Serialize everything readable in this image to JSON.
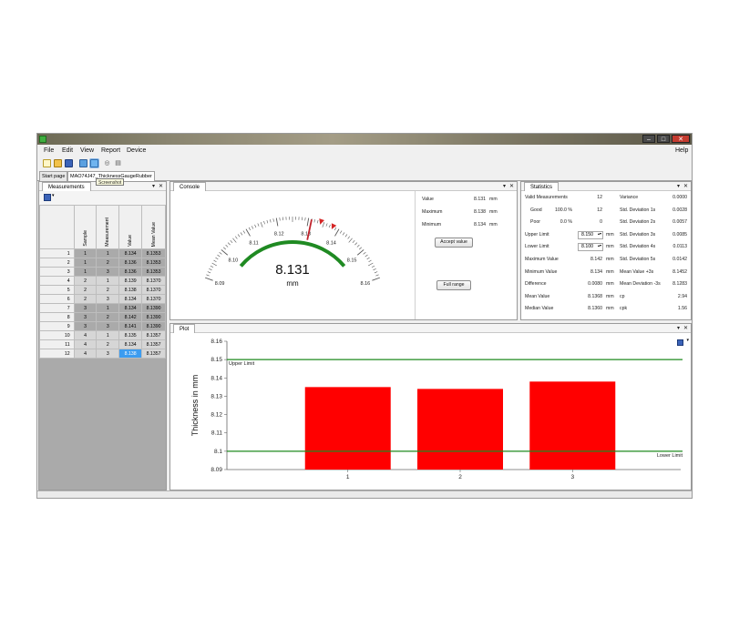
{
  "window": {
    "minimize": "–",
    "maximize": "□",
    "close": "✕"
  },
  "menu": {
    "items": [
      "File",
      "Edit",
      "View",
      "Report",
      "Device"
    ],
    "help": "Help"
  },
  "toolbar": {
    "icons": [
      "new-file-icon",
      "open-folder-icon",
      "save-icon",
      "chart-icon",
      "screenshot-icon",
      "binoculars-icon",
      "print-icon"
    ]
  },
  "doc_tabs": [
    "Start page",
    "MAO74J47_ThicknessGaugeRubber"
  ],
  "tooltip": "Screenshot",
  "measurements": {
    "title": "Measurements",
    "columns": [
      "Sample",
      "Measurement",
      "Value",
      "Mean Value"
    ],
    "rows": [
      {
        "row": "1",
        "sample": "1",
        "measurement": "1",
        "value": "8.134",
        "mean": "8.1353"
      },
      {
        "row": "2",
        "sample": "1",
        "measurement": "2",
        "value": "8.136",
        "mean": "8.1353"
      },
      {
        "row": "3",
        "sample": "1",
        "measurement": "3",
        "value": "8.136",
        "mean": "8.1353"
      },
      {
        "row": "4",
        "sample": "2",
        "measurement": "1",
        "value": "8.139",
        "mean": "8.1370"
      },
      {
        "row": "5",
        "sample": "2",
        "measurement": "2",
        "value": "8.138",
        "mean": "8.1370"
      },
      {
        "row": "6",
        "sample": "2",
        "measurement": "3",
        "value": "8.134",
        "mean": "8.1370"
      },
      {
        "row": "7",
        "sample": "3",
        "measurement": "1",
        "value": "8.134",
        "mean": "8.1390"
      },
      {
        "row": "8",
        "sample": "3",
        "measurement": "2",
        "value": "8.142",
        "mean": "8.1390"
      },
      {
        "row": "9",
        "sample": "3",
        "measurement": "3",
        "value": "8.141",
        "mean": "8.1390"
      },
      {
        "row": "10",
        "sample": "4",
        "measurement": "1",
        "value": "8.135",
        "mean": "8.1357"
      },
      {
        "row": "11",
        "sample": "4",
        "measurement": "2",
        "value": "8.134",
        "mean": "8.1357"
      },
      {
        "row": "12",
        "sample": "4",
        "measurement": "3",
        "value": "8.138",
        "mean": "8.1357"
      }
    ]
  },
  "console": {
    "title": "Console",
    "gauge": {
      "min": 8.09,
      "max": 8.16,
      "value": 8.131,
      "tick_labels": [
        "8.09",
        "8.10",
        "8.11",
        "8.12",
        "8.13",
        "8.14",
        "8.15",
        "8.16"
      ],
      "display": "8.131",
      "unit": "mm",
      "green_range": [
        8.1,
        8.15
      ],
      "last_value_marker": 8.138,
      "max_marker": 8.138,
      "min_marker": 8.134,
      "colors": {
        "needle": "#c0222b",
        "band": "#1f8a22",
        "marker": "#d42525"
      }
    },
    "readouts": [
      {
        "label": "Value",
        "value": "8.131",
        "unit": "mm"
      },
      {
        "label": "Maximum",
        "value": "8.138",
        "unit": "mm"
      },
      {
        "label": "Minimum",
        "value": "8.134",
        "unit": "mm"
      }
    ],
    "accept_button": "Accept value",
    "full_range_button": "Full range"
  },
  "statistics": {
    "title": "Statistics",
    "left": [
      {
        "label": "Valid Measurements",
        "value": "12"
      },
      {
        "label": "Good",
        "pct": "100.0 %",
        "value": "12"
      },
      {
        "label": "Poor",
        "pct": "0.0 %",
        "value": "0"
      },
      {
        "label": "Upper Limit",
        "value": "8.150",
        "unit": "mm"
      },
      {
        "label": "Lower Limit",
        "value": "8.100",
        "unit": "mm"
      },
      {
        "label": "Maximum Value",
        "value": "8.142",
        "unit": "mm"
      },
      {
        "label": "Minimum Value",
        "value": "8.134",
        "unit": "mm"
      },
      {
        "label": "Difference",
        "value": "0.0080",
        "unit": "mm"
      },
      {
        "label": "Mean Value",
        "value": "8.1368",
        "unit": "mm"
      },
      {
        "label": "Median Value",
        "value": "8.1360",
        "unit": "mm"
      }
    ],
    "right": [
      {
        "label": "Variance",
        "value": "0.0000"
      },
      {
        "label": "Std. Deviation 1s",
        "value": "0.0028"
      },
      {
        "label": "Std. Deviation 2s",
        "value": "0.0057"
      },
      {
        "label": "Std. Deviation 3s",
        "value": "0.0085"
      },
      {
        "label": "Std. Deviation 4s",
        "value": "0.0113"
      },
      {
        "label": "Std. Deviation 5s",
        "value": "0.0142"
      },
      {
        "label": "Mean Value +3s",
        "value": "8.1452"
      },
      {
        "label": "Mean Deviation -3s",
        "value": "8.1283"
      },
      {
        "label": "cp",
        "value": "2.94"
      },
      {
        "label": "cpk",
        "value": "1.56"
      }
    ]
  },
  "plot": {
    "title": "Plot",
    "ylabel": "Thickness in mm",
    "upper_limit_label": "Upper Limit",
    "lower_limit_label": "Lower Limit"
  },
  "chart_data": {
    "type": "bar",
    "categories": [
      "1",
      "2",
      "3"
    ],
    "values": [
      8.135,
      8.134,
      8.138
    ],
    "ylim": [
      8.09,
      8.16
    ],
    "yticks": [
      "8.09",
      "8.1",
      "8.11",
      "8.12",
      "8.13",
      "8.14",
      "8.15",
      "8.16"
    ],
    "ylabel": "Thickness in mm",
    "reference_lines": [
      {
        "name": "Upper Limit",
        "value": 8.15
      },
      {
        "name": "Lower Limit",
        "value": 8.1
      }
    ],
    "colors": {
      "bar": "#ff0000",
      "limit": "#1e8a1e"
    },
    "grid": false
  }
}
